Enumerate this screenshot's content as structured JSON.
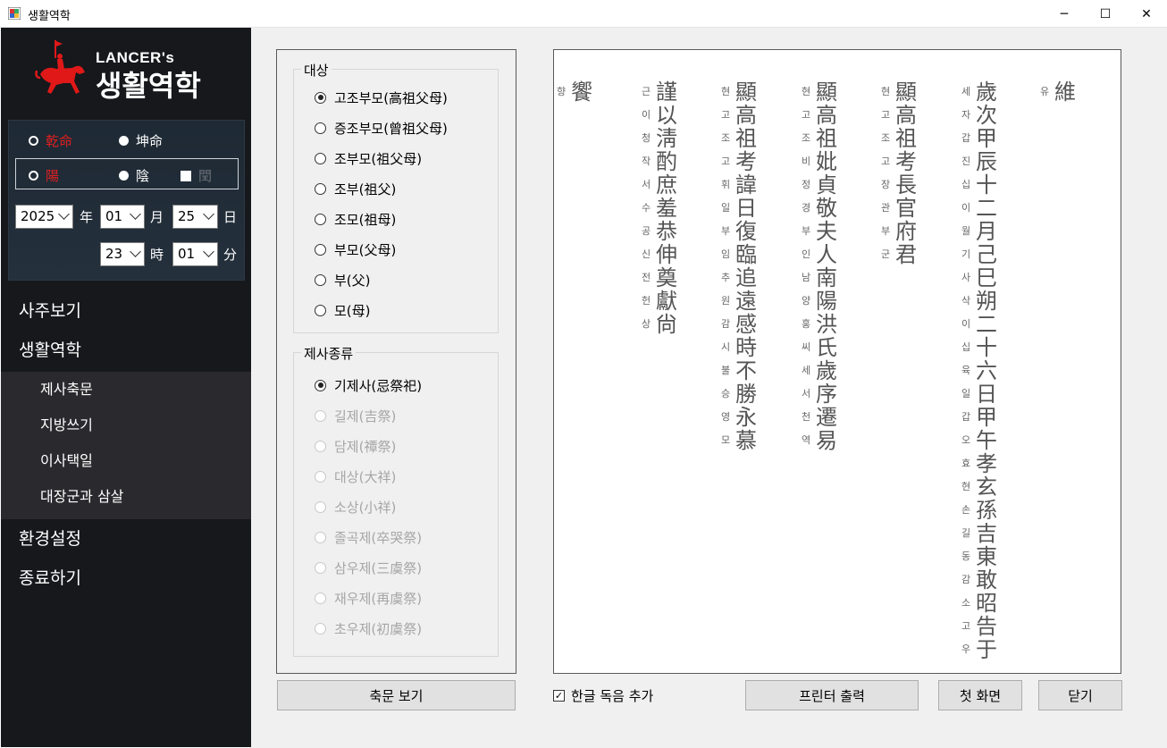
{
  "window": {
    "title": "생활역학",
    "minimize": "─",
    "maximize": "☐",
    "close": "✕"
  },
  "logo": {
    "small": "LANCER's",
    "big": "생활역학"
  },
  "birth": {
    "gender": [
      "乾命",
      "坤命"
    ],
    "calendar": [
      "陽",
      "陰",
      "閏"
    ],
    "year": "2025",
    "year_unit": "年",
    "month": "01",
    "month_unit": "月",
    "day": "25",
    "day_unit": "日",
    "hour": "23",
    "hour_unit": "時",
    "minute": "01",
    "minute_unit": "分"
  },
  "menu": {
    "saju": "사주보기",
    "life": "생활역학",
    "sub": [
      "제사축문",
      "지방쓰기",
      "이사택일",
      "대장군과 삼살"
    ],
    "settings": "환경설정",
    "exit": "종료하기"
  },
  "target": {
    "title": "대상",
    "options": [
      "고조부모(高祖父母)",
      "증조부모(曾祖父母)",
      "조부모(祖父母)",
      "조부(祖父)",
      "조모(祖母)",
      "부모(父母)",
      "부(父)",
      "모(母)"
    ],
    "selected": 0
  },
  "ritual": {
    "title": "제사종류",
    "options": [
      "기제사(忌祭祀)",
      "길제(吉祭)",
      "담제(禫祭)",
      "대상(大祥)",
      "소상(小祥)",
      "졸곡제(卒哭祭)",
      "삼우제(三虞祭)",
      "재우제(再虞祭)",
      "초우제(初虞祭)"
    ],
    "selected": 0
  },
  "buttons": {
    "view": "축문 보기",
    "print": "프린터 출력",
    "home": "첫 화면",
    "close": "닫기"
  },
  "checkbox": {
    "label": "한글 독음 추가",
    "checked": true
  },
  "chukmun": [
    {
      "small": [
        "유"
      ],
      "big": [
        "維"
      ]
    },
    {
      "small": [
        "세",
        "자",
        "갑",
        "진",
        "십",
        "이",
        "월",
        "기",
        "사",
        "삭",
        "이",
        "십",
        "육",
        "일",
        "갑",
        "오",
        "효",
        "현",
        "손",
        "길",
        "동",
        "감",
        "소",
        "고",
        "우"
      ],
      "big": [
        "歲",
        "次",
        "甲",
        "辰",
        "十",
        "二",
        "月",
        "己",
        "巳",
        "朔",
        "二",
        "十",
        "六",
        "日",
        "甲",
        "午",
        "孝",
        "玄",
        "孫",
        "吉",
        "東",
        "敢",
        "昭",
        "告",
        "于"
      ]
    },
    {
      "small": [
        "현",
        "고",
        "조",
        "고",
        "장",
        "관",
        "부",
        "군"
      ],
      "big": [
        "顯",
        "高",
        "祖",
        "考",
        "長",
        "官",
        "府",
        "君"
      ]
    },
    {
      "small": [
        "현",
        "고",
        "조",
        "비",
        "정",
        "경",
        "부",
        "인",
        "남",
        "양",
        "홍",
        "씨",
        "세",
        "서",
        "천",
        "역"
      ],
      "big": [
        "顯",
        "高",
        "祖",
        "妣",
        "貞",
        "敬",
        "夫",
        "人",
        "南",
        "陽",
        "洪",
        "氏",
        "歲",
        "序",
        "遷",
        "易"
      ]
    },
    {
      "small": [
        "현",
        "고",
        "조",
        "고",
        "휘",
        "일",
        "부",
        "임",
        "추",
        "원",
        "감",
        "시",
        "불",
        "승",
        "영",
        "모"
      ],
      "big": [
        "顯",
        "高",
        "祖",
        "考",
        "諱",
        "日",
        "復",
        "臨",
        "追",
        "遠",
        "感",
        "時",
        "不",
        "勝",
        "永",
        "慕"
      ]
    },
    {
      "small": [
        "근",
        "이",
        "청",
        "작",
        "서",
        "수",
        "공",
        "신",
        "전",
        "헌",
        "상"
      ],
      "big": [
        "謹",
        "以",
        "淸",
        "酌",
        "庶",
        "羞",
        "恭",
        "伸",
        "奠",
        "獻",
        "尙"
      ]
    },
    {
      "small": [
        "향"
      ],
      "big": [
        "饗"
      ]
    }
  ]
}
